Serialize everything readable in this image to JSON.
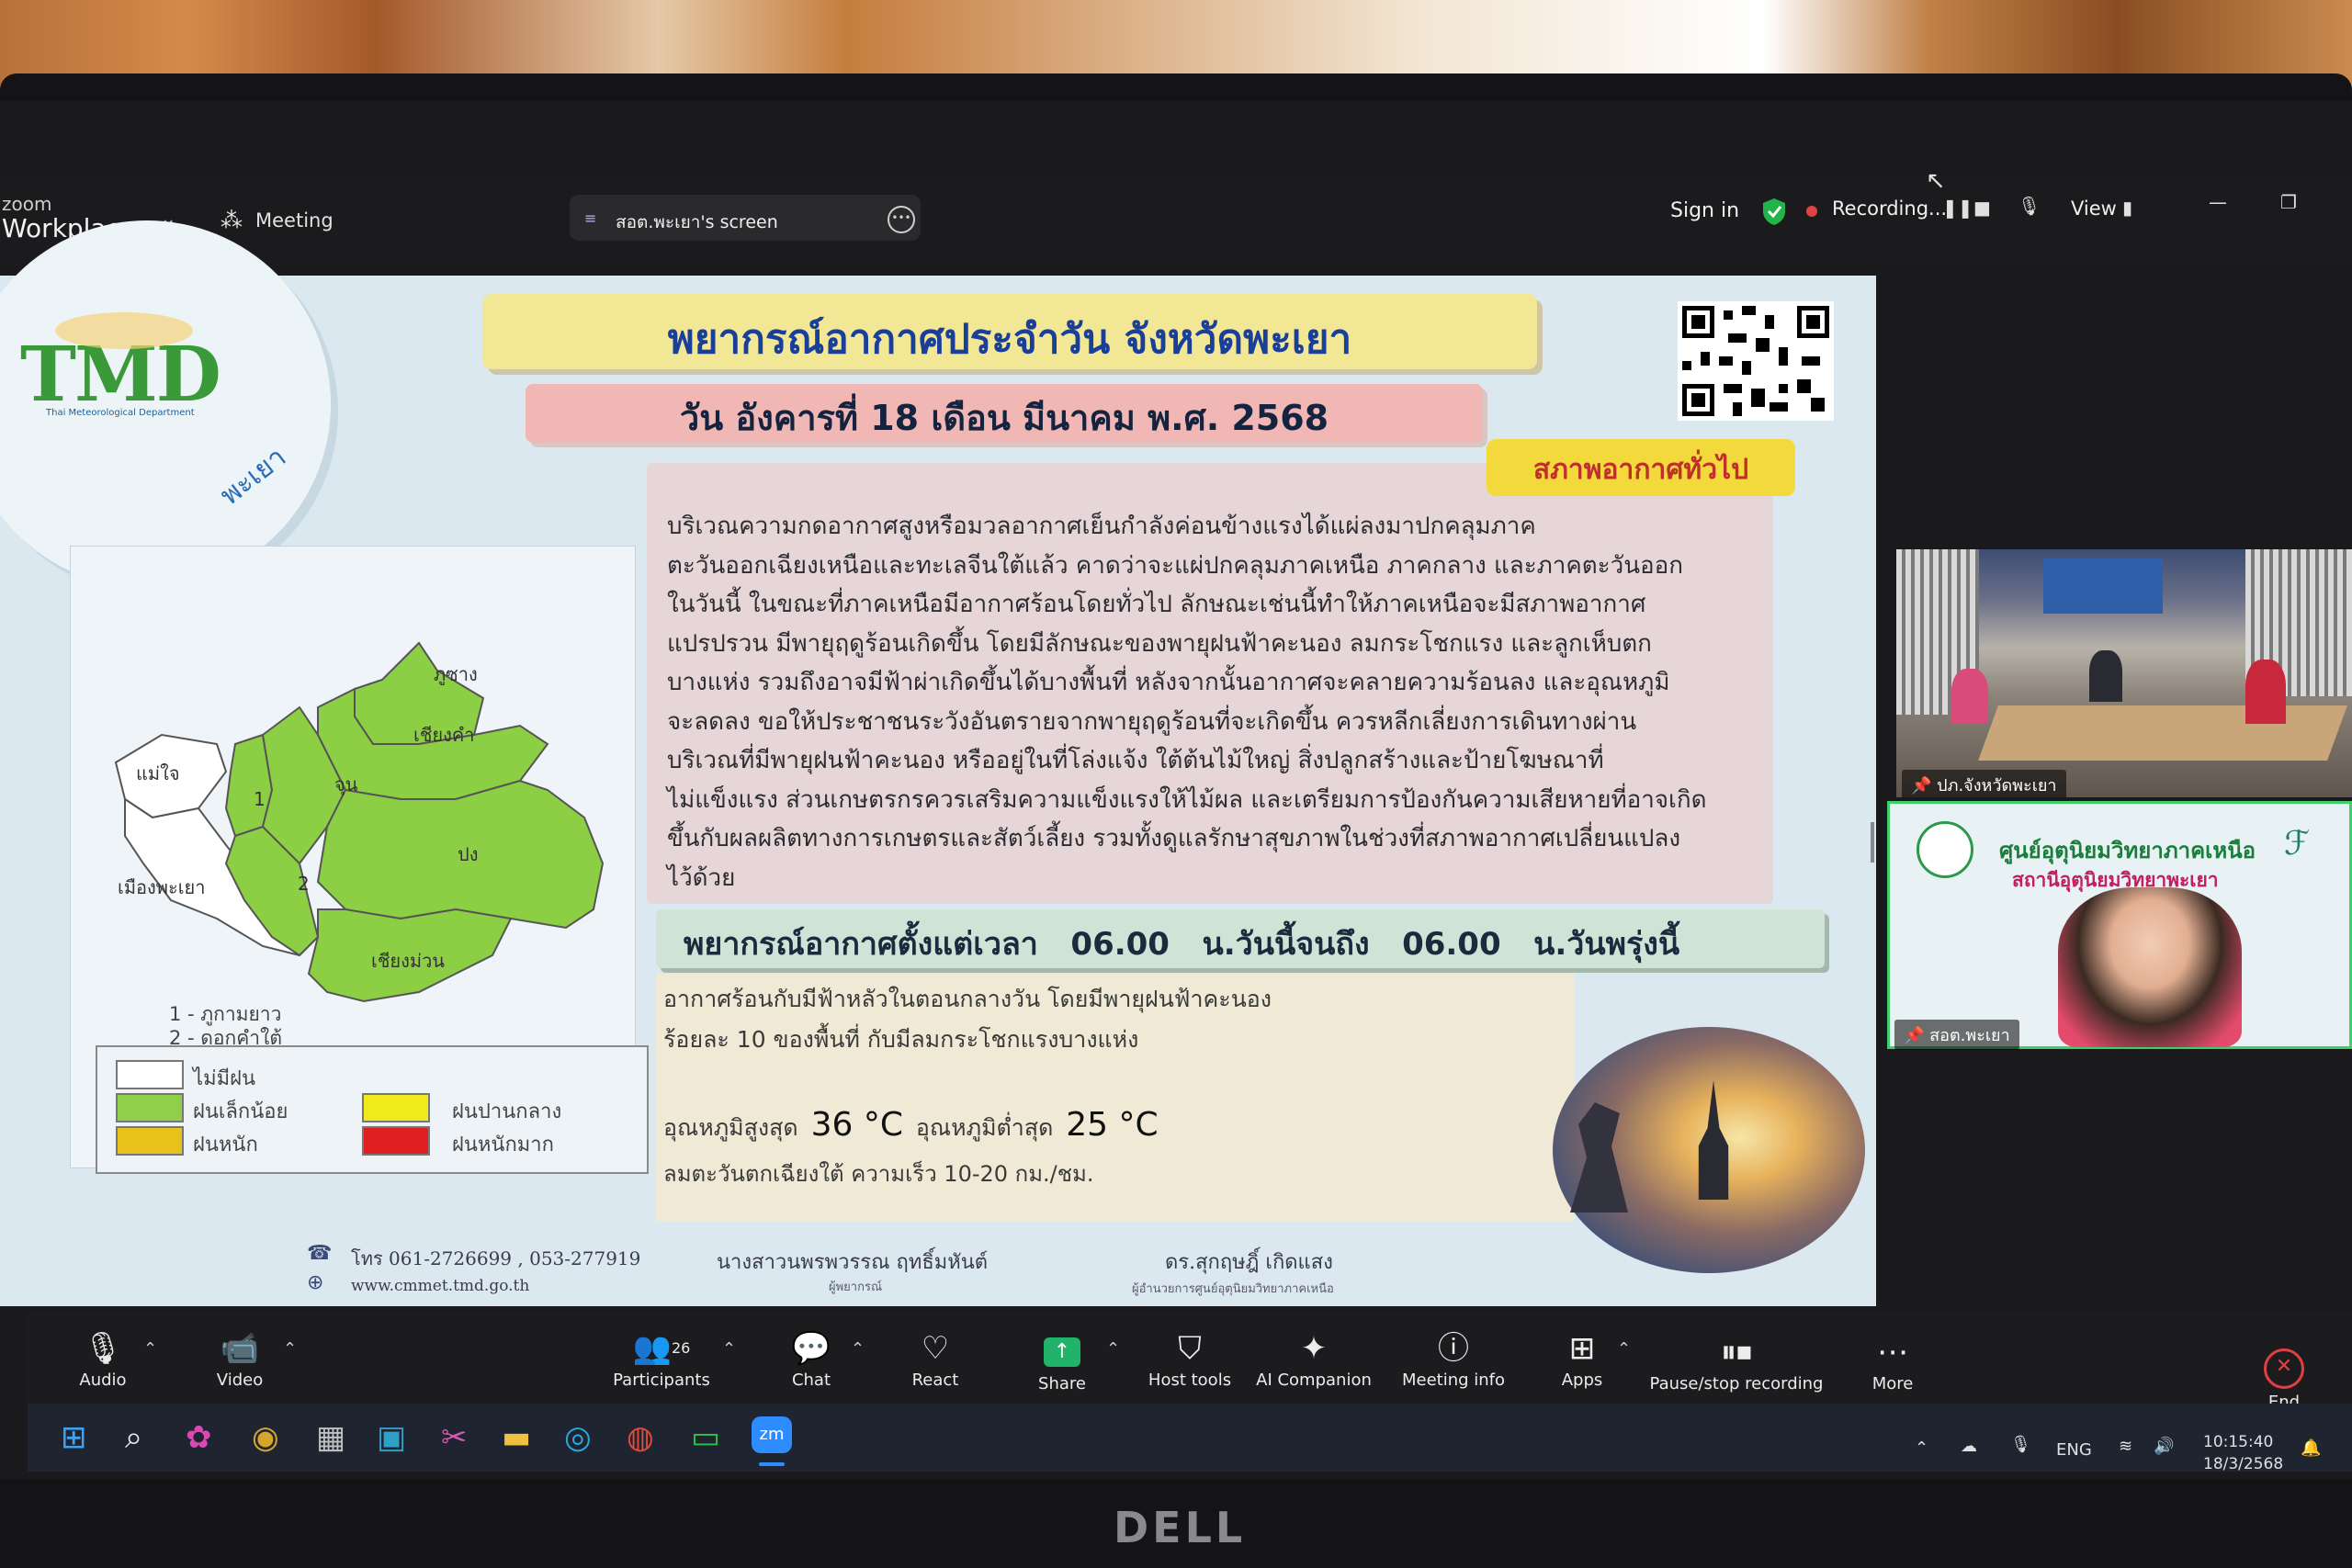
{
  "zoom": {
    "brand_small": "zoom",
    "brand_big": "Workplace",
    "meeting_label": "Meeting",
    "share_title": "สอต.พะเยา's screen",
    "sign_in": "Sign in",
    "recording": "Recording...",
    "view": "View"
  },
  "slide": {
    "logo": "TMD",
    "logo_sub": "Thai Meteorological Department",
    "province_tag": "พะเยา",
    "title": "พยากรณ์อากาศประจำวัน จังหวัดพะเยา",
    "date": "วัน อังคารที่ 18 เดือน มีนาคม พ.ศ. 2568",
    "section_label": "สภาพอากาศทั่วไป",
    "general_lines": [
      "บริเวณความกดอากาศสูงหรือมวลอากาศเย็นกำลังค่อนข้างแรงได้แผ่ลงมาปกคลุมภาค",
      "ตะวันออกเฉียงเหนือและทะเลจีนใต้แล้ว คาดว่าจะแผ่ปกคลุมภาคเหนือ ภาคกลาง และภาคตะวันออก",
      "ในวันนี้ ในขณะที่ภาคเหนือมีอากาศร้อนโดยทั่วไป ลักษณะเช่นนี้ทำให้ภาคเหนือจะมีสภาพอากาศ",
      "แปรปรวน มีพายุฤดูร้อนเกิดขึ้น โดยมีลักษณะของพายุฝนฟ้าคะนอง ลมกระโชกแรง และลูกเห็บตก",
      "บางแห่ง รวมถึงอาจมีฟ้าผ่าเกิดขึ้นได้บางพื้นที่ หลังจากนั้นอากาศจะคลายความร้อนลง และอุณหภูมิ",
      "จะลดลง ขอให้ประชาชนระวังอันตรายจากพายุฤดูร้อนที่จะเกิดขึ้น ควรหลีกเลี่ยงการเดินทางผ่าน",
      "บริเวณที่มีพายุฝนฟ้าคะนอง หรืออยู่ในที่โล่งแจ้ง ใต้ต้นไม้ใหญ่ สิ่งปลูกสร้างและป้ายโฆษณาที่",
      "ไม่แข็งแรง ส่วนเกษตรกรควรเสริมความแข็งแรงให้ไม้ผล และเตรียมการป้องกันความเสียหายที่อาจเกิด",
      "ขึ้นกับผลผลิตทางการเกษตรและสัตว์เลี้ยง รวมทั้งดูแลรักษาสุขภาพในช่วงที่สภาพอากาศเปลี่ยนแปลง",
      "ไว้ด้วย"
    ],
    "forecast_heading": "พยากรณ์อากาศตั้งแต่เวลา   06.00   น.วันนี้จนถึง   06.00   น.วันพรุ่งนี้",
    "forecast_line1": "อากาศร้อนกับมีฟ้าหลัวในตอนกลางวัน โดยมีพายุฝนฟ้าคะนอง",
    "forecast_line2": "ร้อยละ 10 ของพื้นที่ กับมีลมกระโชกแรงบางแห่ง",
    "temp_max_label": "อุณหภูมิสูงสุด",
    "temp_max": "36 °C",
    "temp_min_label": "อุณหภูมิต่ำสุด",
    "temp_min": "25 °C",
    "wind": "ลมตะวันตกเฉียงใต้ ความเร็ว 10-20 กม./ชม.",
    "phone": "โทร 061-2726699 , 053-277919",
    "website": "www.cmmet.tmd.go.th",
    "person1_name": "นางสาวนพรพวรรณ ฤทธิ์มหันต์",
    "person1_role": "ผู้พยากรณ์",
    "person2_name": "ดร.สุกฤษฎิ์ เกิดแสง",
    "person2_role": "ผู้อำนวยการศูนย์อุตุนิยมวิทยาภาคเหนือ",
    "map": {
      "districts": [
        "แม่ใจ",
        "ภูซาง",
        "เชียงคำ",
        "จุน",
        "ปง",
        "เมืองพะเยา",
        "เชียงม่วน",
        "1",
        "2"
      ],
      "notes": [
        "1 - ภูกามยาว",
        "2 - ดอกคำใต้"
      ],
      "legend": [
        {
          "label": "ไม่มีฝน",
          "color": "#ffffff"
        },
        {
          "label": "ฝนเล็กน้อย",
          "color": "#8fcf4a"
        },
        {
          "label": "ฝนปานกลาง",
          "color": "#f0ea1c"
        },
        {
          "label": "ฝนหนัก",
          "color": "#e8c21a"
        },
        {
          "label": "ฝนหนักมาก",
          "color": "#e02020"
        }
      ]
    }
  },
  "videos": {
    "tile1_label": "ปภ.จังหวัดพะเยา",
    "tile2_label": "สอต.พะเยา",
    "tile2_title1": "ศูนย์อุตุนิยมวิทยาภาคเหนือ",
    "tile2_title2": "สถานีอุตุนิยมวิทยาพะเยา"
  },
  "toolbar": {
    "audio": "Audio",
    "video": "Video",
    "participants": "Participants",
    "participants_count": "26",
    "chat": "Chat",
    "react": "React",
    "share": "Share",
    "host_tools": "Host tools",
    "ai_companion": "AI Companion",
    "meeting_info": "Meeting info",
    "apps": "Apps",
    "pause_stop": "Pause/stop recording",
    "more": "More",
    "end": "End"
  },
  "taskbar": {
    "lang": "ENG",
    "time": "10:15:40",
    "date": "18/3/2568"
  },
  "monitor_brand": "DELL"
}
